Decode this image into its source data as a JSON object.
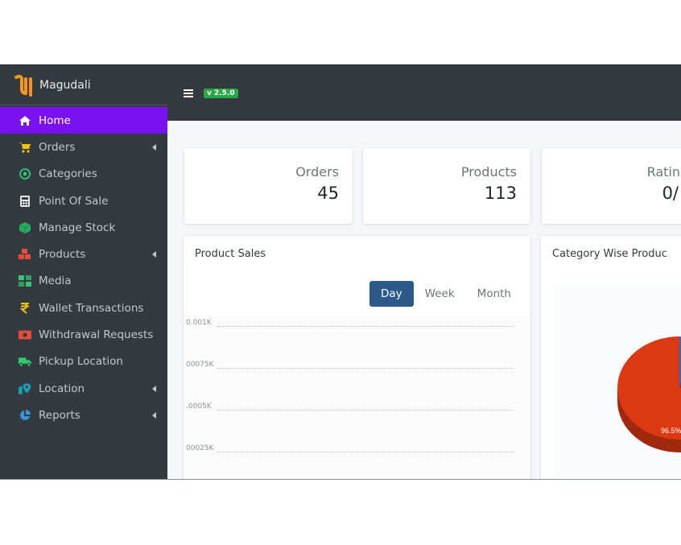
{
  "brand": {
    "name": "Magudali"
  },
  "header": {
    "version": "v 2.5.0"
  },
  "sidebar": {
    "items": [
      {
        "label": "Home",
        "icon": "home-icon",
        "active": true,
        "has_submenu": false
      },
      {
        "label": "Orders",
        "icon": "cart-icon",
        "has_submenu": true
      },
      {
        "label": "Categories",
        "icon": "target-icon",
        "has_submenu": false
      },
      {
        "label": "Point Of Sale",
        "icon": "calculator-icon",
        "has_submenu": false
      },
      {
        "label": "Manage Stock",
        "icon": "cube-icon",
        "has_submenu": false
      },
      {
        "label": "Products",
        "icon": "cubes-icon",
        "has_submenu": true
      },
      {
        "label": "Media",
        "icon": "photo-icon",
        "has_submenu": false
      },
      {
        "label": "Wallet Transactions",
        "icon": "rupee-icon",
        "has_submenu": false
      },
      {
        "label": "Withdrawal Requests",
        "icon": "money-bill-icon",
        "has_submenu": false
      },
      {
        "label": "Pickup Location",
        "icon": "truck-icon",
        "has_submenu": false
      },
      {
        "label": "Location",
        "icon": "map-marker-icon",
        "has_submenu": true
      },
      {
        "label": "Reports",
        "icon": "pie-chart-icon",
        "has_submenu": true
      }
    ]
  },
  "stats": [
    {
      "label": "Orders",
      "value": "45"
    },
    {
      "label": "Products",
      "value": "113"
    },
    {
      "label": "Ratin",
      "value": "0/"
    }
  ],
  "product_sales": {
    "title": "Product Sales",
    "tabs": [
      "Day",
      "Week",
      "Month"
    ],
    "active_tab": "Day"
  },
  "category_chart": {
    "title": "Category Wise Produc",
    "slice_label": "96.5%"
  },
  "chart_data": [
    {
      "type": "line",
      "title": "Product Sales",
      "y_ticks": [
        "0.001K",
        "00075K",
        ".0005K",
        "00025K"
      ],
      "ylim": [
        0,
        0.001
      ],
      "grid": true
    },
    {
      "type": "pie",
      "title": "Category Wise Produc",
      "values": [
        96.5,
        3.5
      ],
      "data_labels": [
        "96.5%",
        ""
      ],
      "colors": [
        "#dc3912",
        "#3366cc"
      ]
    }
  ],
  "colors": {
    "sidebar": "#343a40",
    "active_item": "#7a12f0",
    "version_badge": "#28a745",
    "day_button": "#2b5a8a",
    "pie_main": "#dc3912",
    "pie_secondary": "#3366cc"
  }
}
